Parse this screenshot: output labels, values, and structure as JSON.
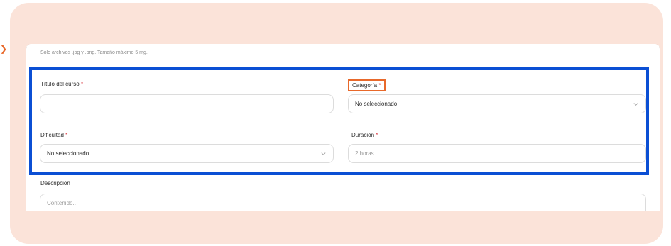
{
  "form": {
    "hint": "Solo archivos .jpg y .png. Tamaño máximo 5 mg.",
    "required_mark": "*",
    "course_title": {
      "label": "Título del curso",
      "value": ""
    },
    "category": {
      "label": "Categoría",
      "value": "No seleccionado"
    },
    "difficulty": {
      "label": "Dificultad",
      "value": "No seleccionado"
    },
    "duration": {
      "label": "Duración",
      "placeholder": "2 horas"
    },
    "description": {
      "label": "Descripción",
      "placeholder": "Contenido.."
    }
  },
  "colors": {
    "highlight_blue": "#0b4fd4",
    "highlight_orange": "#e8692b",
    "background": "#fbe3d9"
  }
}
